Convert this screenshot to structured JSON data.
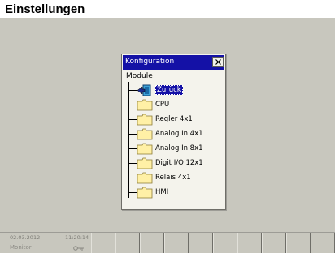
{
  "header": {
    "title": "Einstellungen"
  },
  "dialog": {
    "title": "Konfiguration",
    "close_glyph": "×",
    "section_label": "Module",
    "items": [
      {
        "label": "Zurück",
        "icon": "back-arrow-icon",
        "selected": true
      },
      {
        "label": "CPU",
        "icon": "folder-icon"
      },
      {
        "label": "Regler 4x1",
        "icon": "folder-icon"
      },
      {
        "label": "Analog In 4x1",
        "icon": "folder-icon"
      },
      {
        "label": "Analog In 8x1",
        "icon": "folder-icon"
      },
      {
        "label": "Digit I/O 12x1",
        "icon": "folder-icon"
      },
      {
        "label": "Relais 4x1",
        "icon": "folder-icon"
      },
      {
        "label": "HMI",
        "icon": "folder-icon"
      }
    ]
  },
  "status_bar": {
    "date": "02.03.2012",
    "time": "11:20:14",
    "user": "Monitor",
    "user_icon": "key-icon"
  },
  "function_keys": [
    "",
    "",
    "",
    "",
    "",
    "",
    "",
    "",
    "",
    ""
  ],
  "colors": {
    "background": "#c8c7be",
    "titlebar": "#1411a6",
    "dialog": "#f4f3ec",
    "folder": "#fff0a6",
    "selection": "#1411a6"
  }
}
